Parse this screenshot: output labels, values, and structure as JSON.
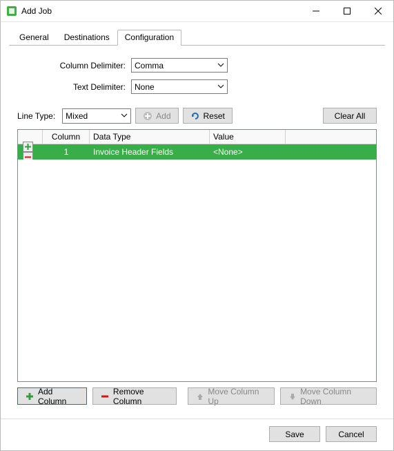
{
  "window": {
    "title": "Add Job"
  },
  "tabs": [
    {
      "label": "General",
      "active": false
    },
    {
      "label": "Destinations",
      "active": false
    },
    {
      "label": "Configuration",
      "active": true
    }
  ],
  "form": {
    "column_delimiter_label": "Column Delimiter:",
    "column_delimiter_value": "Comma",
    "text_delimiter_label": "Text Delimiter:",
    "text_delimiter_value": "None"
  },
  "linebar": {
    "line_type_label": "Line Type:",
    "line_type_value": "Mixed",
    "add_label": "Add",
    "reset_label": "Reset",
    "clear_all_label": "Clear All"
  },
  "grid": {
    "headers": {
      "column": "Column",
      "data_type": "Data Type",
      "value": "Value"
    },
    "rows": [
      {
        "column": "1",
        "data_type": "Invoice Header Fields",
        "value": "<None>"
      }
    ]
  },
  "column_buttons": {
    "add": "Add Column",
    "remove": "Remove Column",
    "up": "Move Column Up",
    "down": "Move Column Down"
  },
  "footer": {
    "save": "Save",
    "cancel": "Cancel"
  }
}
